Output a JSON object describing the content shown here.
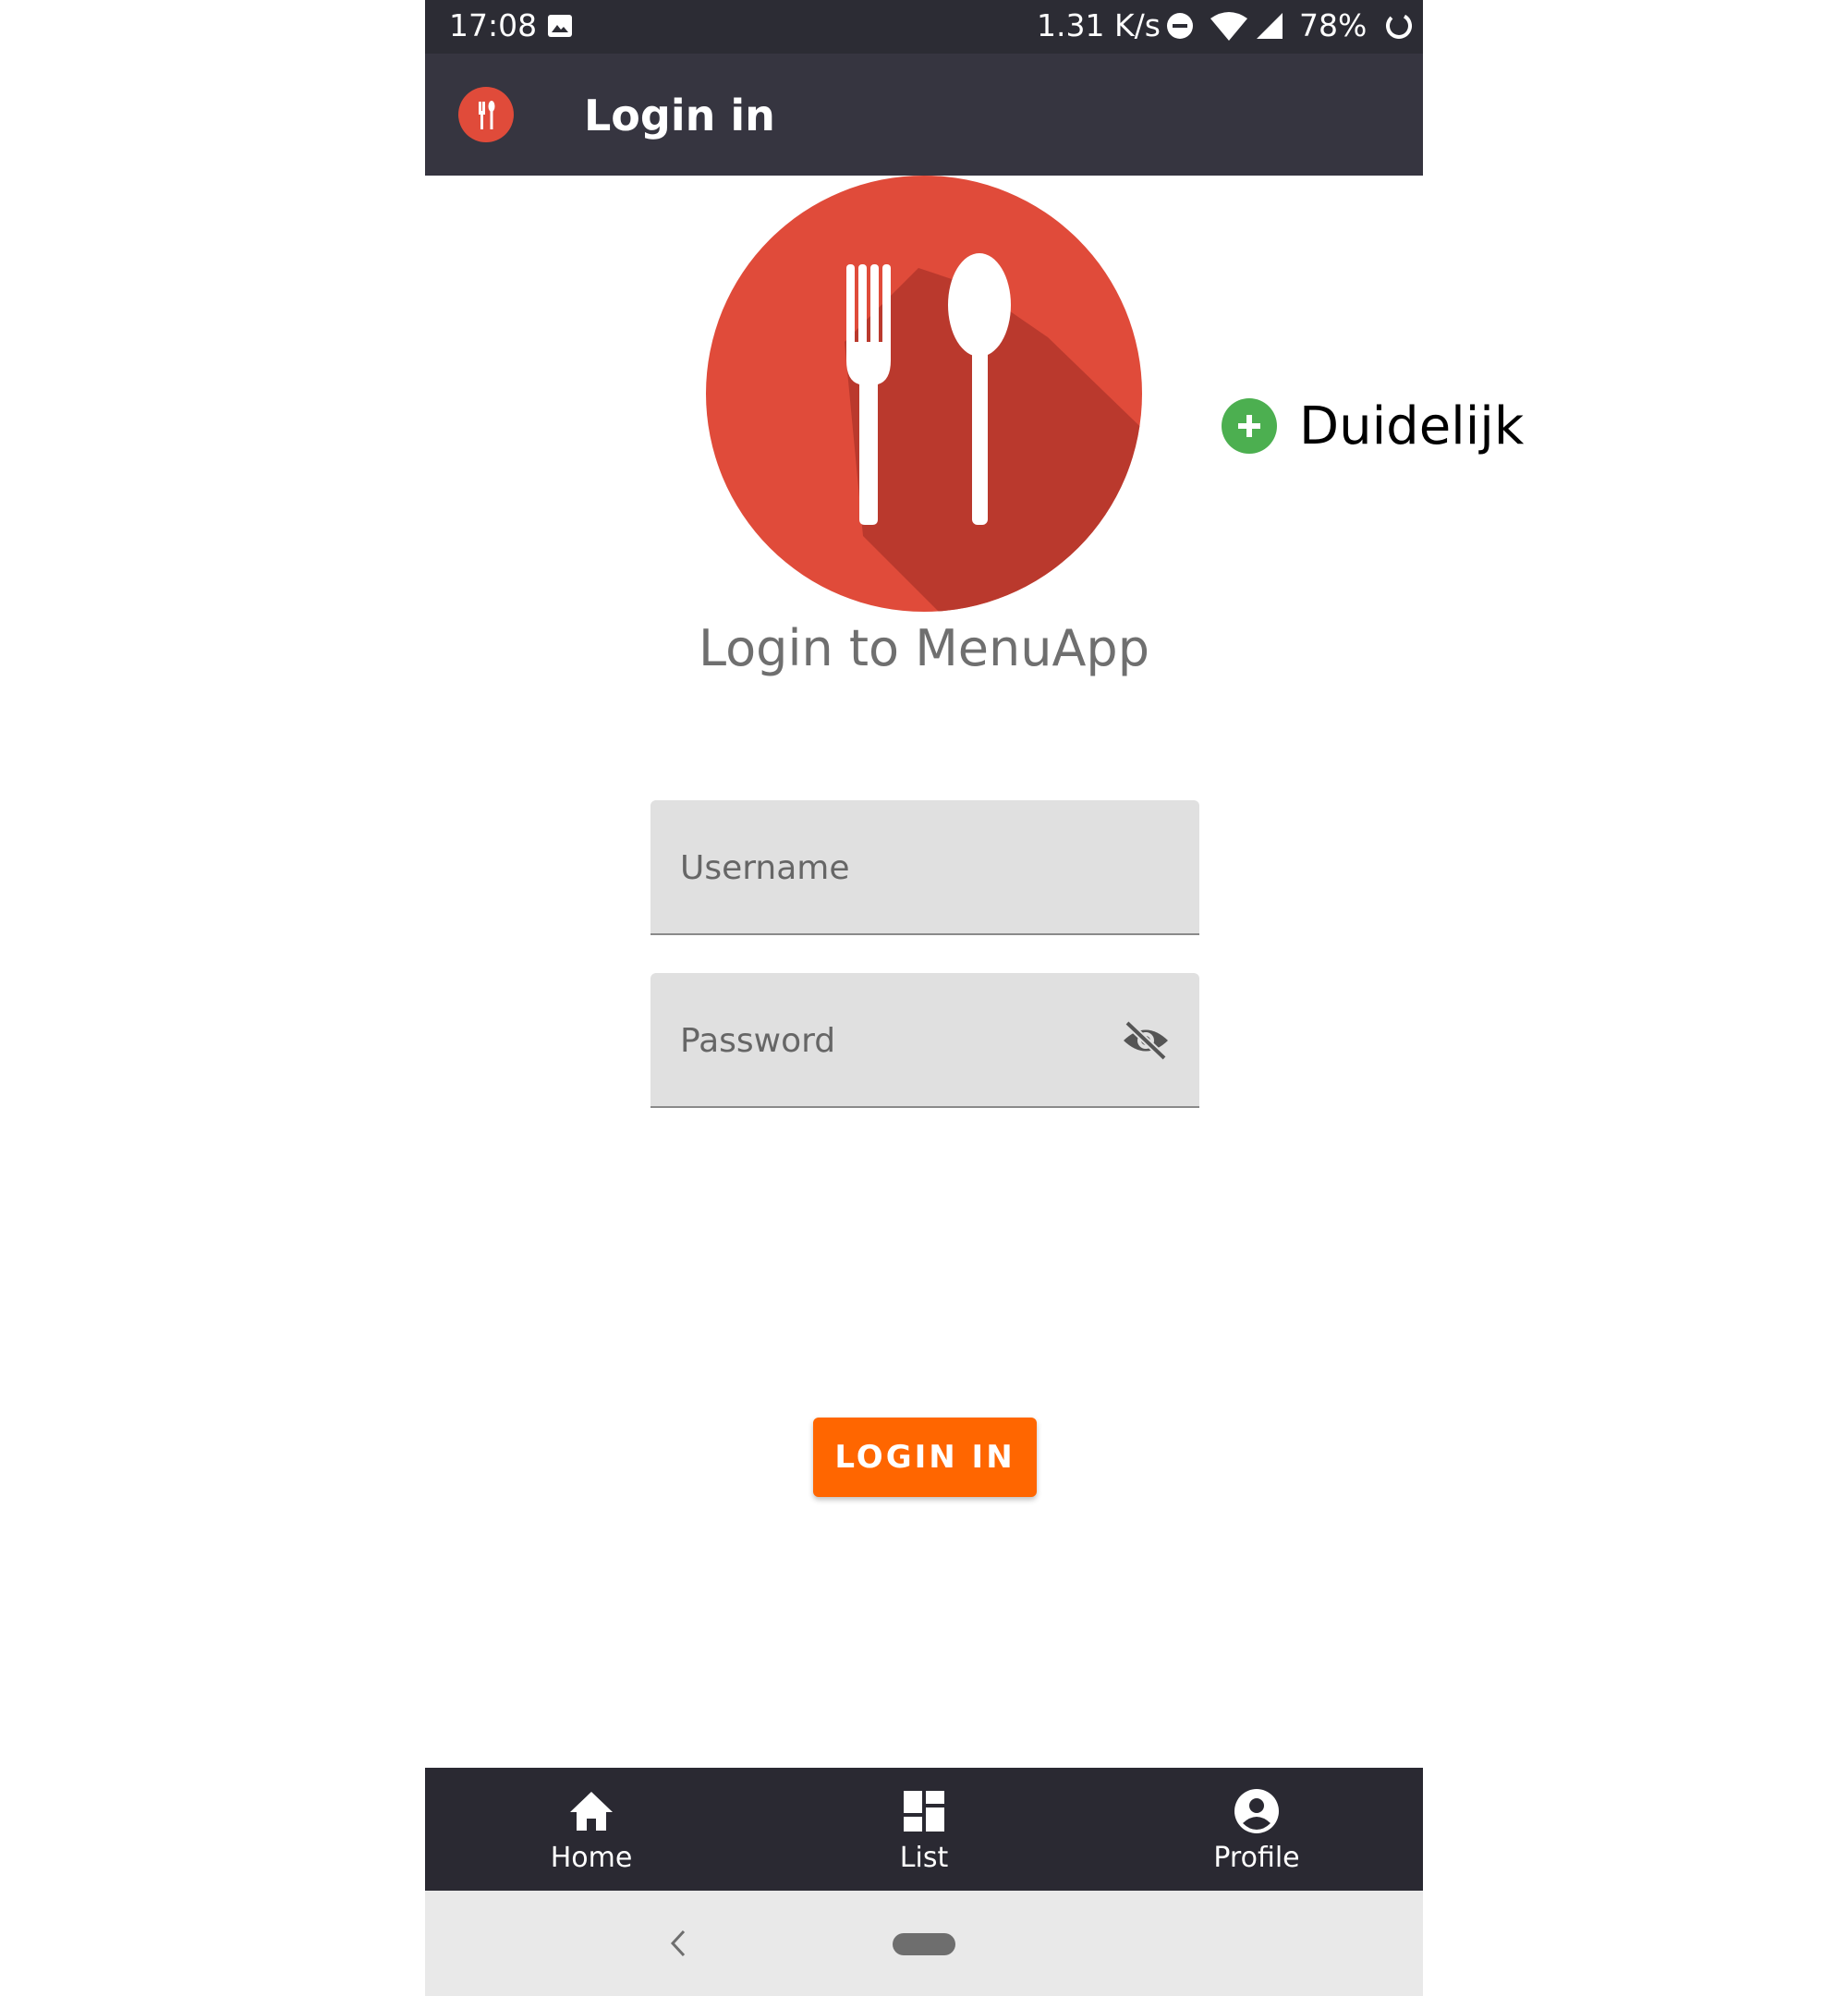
{
  "status_bar": {
    "time": "17:08",
    "network_speed": "1.31 K/s",
    "battery_level": "78%",
    "icons": [
      "gallery-icon",
      "do-not-disturb-icon",
      "wifi-icon",
      "signal-icon",
      "battery-icon"
    ]
  },
  "app_bar": {
    "title": "Login in",
    "logo_icon": "fork-spoon-icon"
  },
  "hero": {
    "logo_icon": "fork-spoon-icon",
    "caption": "Login to MenuApp"
  },
  "form": {
    "username_placeholder": "Username",
    "username_value": "",
    "password_placeholder": "Password",
    "password_value": "",
    "password_toggle_icon": "eye-off-icon"
  },
  "login_button_label": "LOGIN IN",
  "bottom_nav": {
    "items": [
      {
        "label": "Home",
        "icon": "home-icon"
      },
      {
        "label": "List",
        "icon": "dashboard-icon"
      },
      {
        "label": "Profile",
        "icon": "account-circle-icon"
      }
    ]
  },
  "system_nav": {
    "icons": [
      "back-icon",
      "home-pill"
    ]
  },
  "annotation": {
    "label": "Duidelijk",
    "icon": "plus-circle-icon"
  },
  "colors": {
    "status_bar": "#2c2c34",
    "app_bar": "#363540",
    "logo_red": "#e04b3a",
    "logo_shadow": "#b3362b",
    "field_background": "#e0e0e0",
    "login_button": "#ff6600",
    "bottom_nav": "#2a2932",
    "system_nav": "#e9e9e9",
    "annotation_green": "#4caf50"
  }
}
